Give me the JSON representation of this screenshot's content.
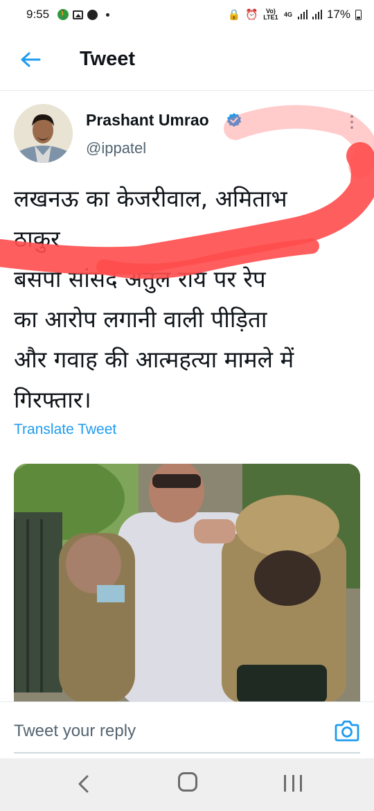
{
  "status_bar": {
    "time": "9:55",
    "network_label": "Vo) LTE1",
    "network_type": "4G",
    "battery": "17%"
  },
  "header": {
    "back_icon": "arrow-left-icon",
    "title": "Tweet"
  },
  "tweet": {
    "author": {
      "name": "Prashant Umrao",
      "handle": "@ippatel",
      "verified": true
    },
    "text_lines": [
      "लखनऊ का केजरीवाल, अमिताभ",
      "ठाकुर",
      "बसपा सांसद अतुल राय पर रेप",
      "का आरोप लगानी वाली पीड़िता",
      "और गवाह की आत्महत्या मामले में",
      "गिरफ्तार।"
    ],
    "translate_label": "Translate Tweet"
  },
  "reply": {
    "placeholder": "Tweet your reply",
    "camera_icon": "camera-icon"
  },
  "colors": {
    "accent": "#1d9bf0",
    "scribble": "#ff4d4d"
  }
}
